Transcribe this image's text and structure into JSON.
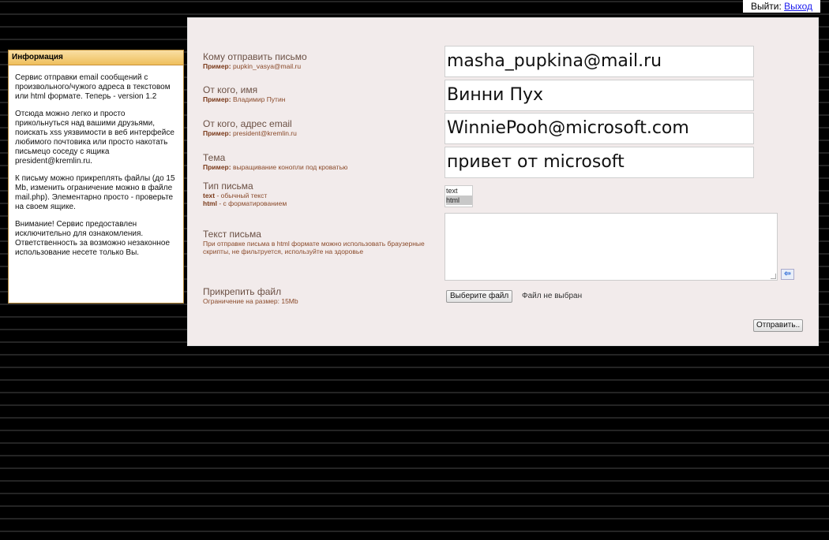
{
  "logout": {
    "prefix": "Выйти:",
    "link": "Выход"
  },
  "info": {
    "title": "Информация",
    "paragraphs": [
      "Сервис отправки email сообщений с произвольного/чужого адреса в текстовом или html формате. Теперь - version 1.2",
      "Отсюда можно легко и просто прикольнуться над вашими друзьями, поискать xss уязвимости в веб интерфейсе любимого почтовика или просто накотать письмецо соседу с ящика president@kremlin.ru.",
      "К письму можно прикреплять файлы (до 15 Mb, изменить ограничение можно в файле mail.php). Элементарно просто - проверьте на своем ящике.",
      "Внимание! Сервис предоставлен исключительно для ознакомления. Ответственность за возможно незаконное использование несете только Вы."
    ]
  },
  "form": {
    "to": {
      "label": "Кому отправить письмо",
      "example_prefix": "Пример:",
      "example": "pupkin_vasya@mail.ru",
      "value": "masha_pupkina@mail.ru"
    },
    "from_name": {
      "label": "От кого, имя",
      "example_prefix": "Пример:",
      "example": "Владимир Путин",
      "value": "Винни Пух"
    },
    "from_email": {
      "label": "От кого, адрес email",
      "example_prefix": "Пример:",
      "example": "president@kremlin.ru",
      "value": "WinniePooh@microsoft.com"
    },
    "subject": {
      "label": "Тема",
      "example_prefix": "Пример:",
      "example": "выращивание конопли под кроватью",
      "value": "привет от microsoft"
    },
    "type": {
      "label": "Тип письма",
      "text_key": "text",
      "text_desc": " - обычный текст",
      "html_key": "html",
      "html_desc": " - с форматированием",
      "options": [
        "text",
        "html"
      ],
      "selected": "html"
    },
    "body": {
      "label": "Текст письма",
      "hint": "При отправке письма в html формате можно использовать браузерные скрипты, не фильтруется, используйте на здоровье",
      "value": ""
    },
    "attach": {
      "label": "Прикрепить файл",
      "hint": "Ограничение на размер: 15Mb",
      "button": "Выберите файл",
      "status": "Файл не выбран"
    },
    "send_button": "Отправить.."
  },
  "icons": {
    "insert": "arrow-left-insert-icon"
  }
}
